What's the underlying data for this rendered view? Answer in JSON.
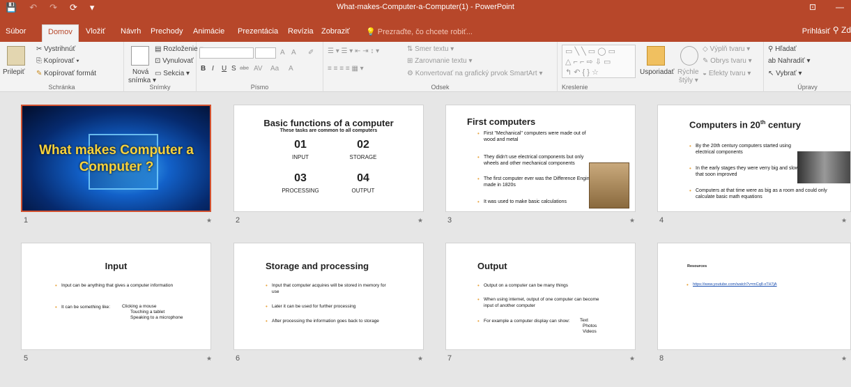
{
  "app": {
    "window_title": "What-makes-Computer-a-Computer(1) - PowerPoint",
    "qat": [
      "💾",
      "↶",
      "↷",
      "⟳",
      "▾"
    ]
  },
  "tabs": [
    "Súbor",
    "Domov",
    "Vložiť",
    "Návrh",
    "Prechody",
    "Animácie",
    "Prezentácia",
    "Revízia",
    "Zobraziť"
  ],
  "active_tab": "Domov",
  "tell_me": "Prezraďte, čo chcete robiť...",
  "sign_in": "Prihlásiť",
  "share_label": "Zd",
  "ribbon": {
    "clipboard": {
      "paste": "Prilepiť",
      "cut": "Vystrihnúť",
      "copy": "Kopírovať",
      "format_painter": "Kopírovať formát",
      "label": "Schránka"
    },
    "slides": {
      "new_slide_line1": "Nová",
      "new_slide_line2": "snímka",
      "layout": "Rozloženie",
      "reset": "Vynulovať",
      "section": "Sekcia",
      "label": "Snímky"
    },
    "font": {
      "bold": "B",
      "italic": "I",
      "underline": "U",
      "shadow": "S",
      "strike": "abc",
      "spacing": "AV",
      "case": "Aa",
      "color": "A",
      "grow": "A",
      "shrink": "A",
      "label": "Písmo"
    },
    "paragraph": {
      "text_direction": "Smer textu",
      "align_text": "Zarovnanie textu",
      "smartart": "Konvertovať na grafický prvok SmartArt",
      "label": "Odsek"
    },
    "drawing": {
      "arrange": "Usporiadať",
      "quick_styles_1": "Rýchle",
      "quick_styles_2": "štýly",
      "shape_fill": "Výplň tvaru",
      "shape_outline": "Obrys tvaru",
      "shape_effects": "Efekty tvaru",
      "label": "Kreslenie"
    },
    "editing": {
      "find": "Hľadať",
      "replace": "Nahradiť",
      "select": "Vybrať",
      "label": "Úpravy"
    }
  },
  "slides": [
    {
      "num": "1",
      "title": "What makes Computer a Computer ?"
    },
    {
      "num": "2",
      "title": "Basic functions of a computer",
      "subtitle": "These tasks are common to all computers",
      "items": [
        {
          "n": "01",
          "label": "INPUT"
        },
        {
          "n": "02",
          "label": "STORAGE"
        },
        {
          "n": "03",
          "label": "PROCESSING"
        },
        {
          "n": "04",
          "label": "OUTPUT"
        }
      ]
    },
    {
      "num": "3",
      "title": "First computers",
      "bullets": [
        "First \"Mechanical\" computers were made out of wood and metal",
        "They didn't use electrical components but only wheels and other mechanical components",
        "The first computer ever was the Difference Engine made in 1820s",
        "It was used to make basic calculations"
      ]
    },
    {
      "num": "4",
      "title": "Computers in 20",
      "title_sup": "th",
      "title_end": " century",
      "bullets": [
        "By the 20th century computers started using electrical components",
        "In the early stages they were verry big and slow but that soon improved",
        "Computers at that time were as big as a room and could only calculate basic math equations"
      ]
    },
    {
      "num": "5",
      "title": "Input",
      "bullets": [
        "Input can be anything that gives a computer information",
        "It can be something like:"
      ],
      "list": [
        "Clicking a mouse",
        "Touching a tablet",
        "Speaking to a microphone"
      ]
    },
    {
      "num": "6",
      "title": "Storage and processing",
      "bullets": [
        "Input that computer acquires will be stored in memory for use",
        "Later it can be used for further processing",
        "After processing the information goes back to storage"
      ]
    },
    {
      "num": "7",
      "title": "Output",
      "bullets": [
        "Output on a computer can be many things",
        "When using internet, output of one computer can become input of another computer",
        "For example a computer display can show:"
      ],
      "list": [
        "Text",
        "Photos",
        "Videos"
      ]
    },
    {
      "num": "8",
      "title": "Resources",
      "link": "https://www.youtube.com/watch?v=mCq8-xTH7jA"
    }
  ],
  "colors": {
    "accent": "#b7472a",
    "selection": "#d35230",
    "bullet": "#e8a33d"
  }
}
